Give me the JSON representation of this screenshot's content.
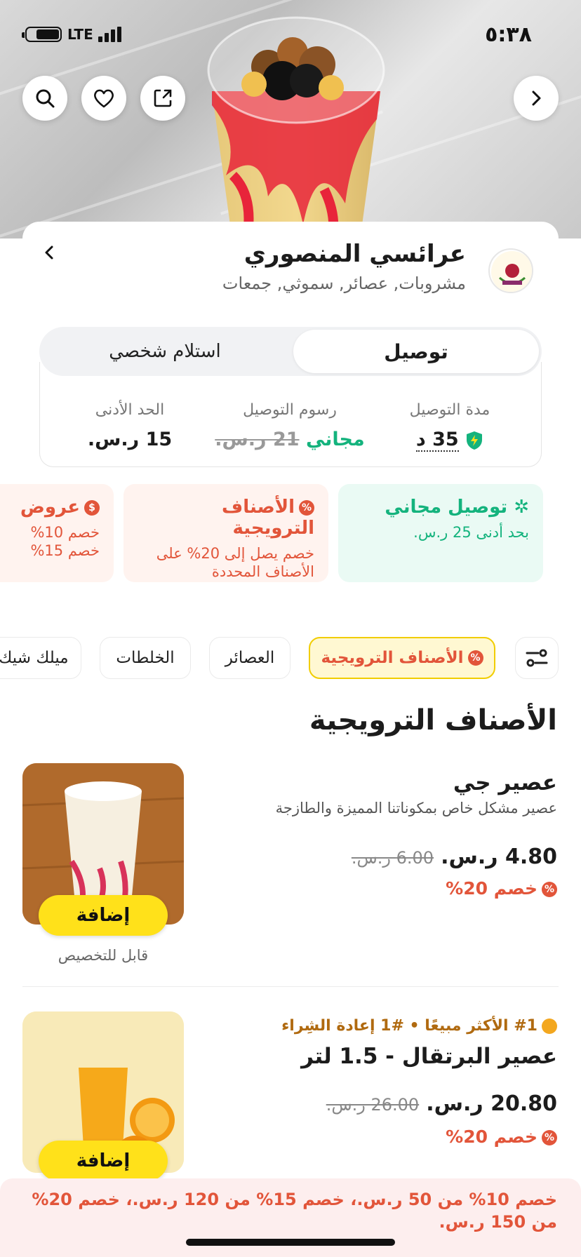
{
  "status_bar": {
    "network": "LTE",
    "time": "٥:٣٨"
  },
  "store": {
    "name": "عرائسي المنصوري",
    "tags": "مشروبات, عصائر, سموثي, جمعات"
  },
  "mode_toggle": {
    "delivery": "توصيل",
    "pickup": "استلام شخصي"
  },
  "delivery_info": {
    "duration_label": "مدة التوصيل",
    "duration_value": "35 د",
    "fee_label": "رسوم التوصيل",
    "fee_free": "مجاني",
    "fee_old": "21 ر.س.",
    "min_label": "الحد الأدنى",
    "min_value": "15 ر.س."
  },
  "promos": [
    {
      "title": "توصيل مجاني",
      "desc": "بحد أدنى 25 ر.س."
    },
    {
      "title": "الأصناف الترويجية",
      "desc": "خصم يصل إلى 20% على الأصناف المحددة"
    },
    {
      "title": "عروض",
      "desc": "خصم 10% خصم 15%"
    }
  ],
  "tabs": [
    {
      "label": "الأصناف الترويجية"
    },
    {
      "label": "العصائر"
    },
    {
      "label": "الخلطات"
    },
    {
      "label": "ميلك شيك"
    }
  ],
  "section_title": "الأصناف الترويجية",
  "items": [
    {
      "name": "عصير جي",
      "desc": "عصير مشكل خاص بمكوناتنا المميزة والطازجة",
      "price": "4.80 ر.س.",
      "old_price": "6.00 ر.س.",
      "discount": "خصم 20%",
      "add_label": "إضافة",
      "custom_label": "قابل للتخصيص"
    },
    {
      "badges": "#1 الأكثر مبيعًا • #1 إعادة الشِراء",
      "name": "عصير البرتقال - 1.5 لتر",
      "price": "20.80 ر.س.",
      "old_price": "26.00 ر.س.",
      "discount": "خصم 20%",
      "add_label": "إضافة"
    }
  ],
  "bottom_banner": "خصم 10% من 50 ر.س.، خصم 15% من 120 ر.س.، خصم 20% من 150 ر.س.",
  "colors": {
    "accent_yellow": "#ffe11a",
    "discount_red": "#e2553a",
    "free_green": "#14b37d"
  }
}
